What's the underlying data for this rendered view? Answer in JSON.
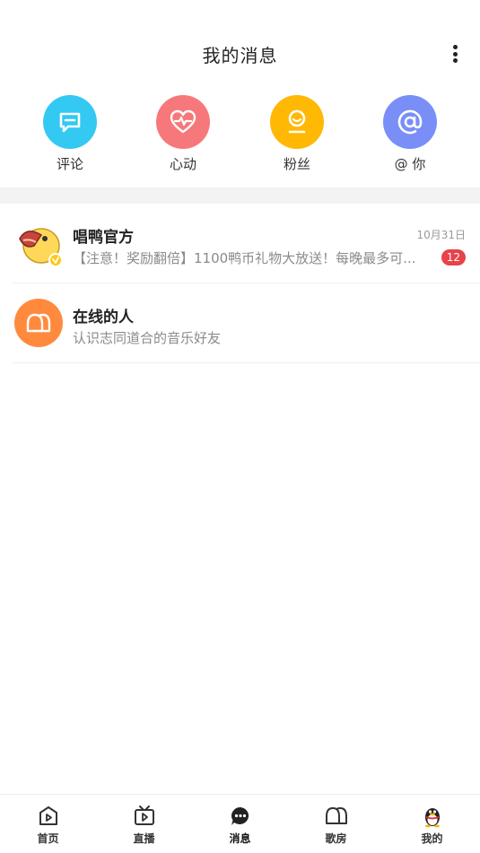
{
  "header": {
    "title": "我的消息"
  },
  "categories": [
    {
      "label": "评论",
      "icon": "comment-icon",
      "color": "#33c9f3"
    },
    {
      "label": "心动",
      "icon": "heart-pulse-icon",
      "color": "#f7787a"
    },
    {
      "label": "粉丝",
      "icon": "fan-person-icon",
      "color": "#ffb804"
    },
    {
      "label": "@ 你",
      "icon": "at-icon",
      "color": "#7a8ef7"
    }
  ],
  "messages": [
    {
      "title": "唱鸭官方",
      "subtitle": "【注意！奖励翻倍】1100鸭币礼物大放送！每晚最多可...",
      "time": "10月31日",
      "badge": "12"
    },
    {
      "title": "在线的人",
      "subtitle": "认识志同道合的音乐好友"
    }
  ],
  "tabs": [
    {
      "label": "首页",
      "icon": "home-play-icon"
    },
    {
      "label": "直播",
      "icon": "tv-live-icon"
    },
    {
      "label": "消息",
      "icon": "chat-bubble-icon",
      "active": true
    },
    {
      "label": "歌房",
      "icon": "room-people-icon"
    },
    {
      "label": "我的",
      "icon": "qq-penguin-icon"
    }
  ],
  "colors": {
    "badge": "#e8424a",
    "online_avatar": "#ff8a3d"
  }
}
